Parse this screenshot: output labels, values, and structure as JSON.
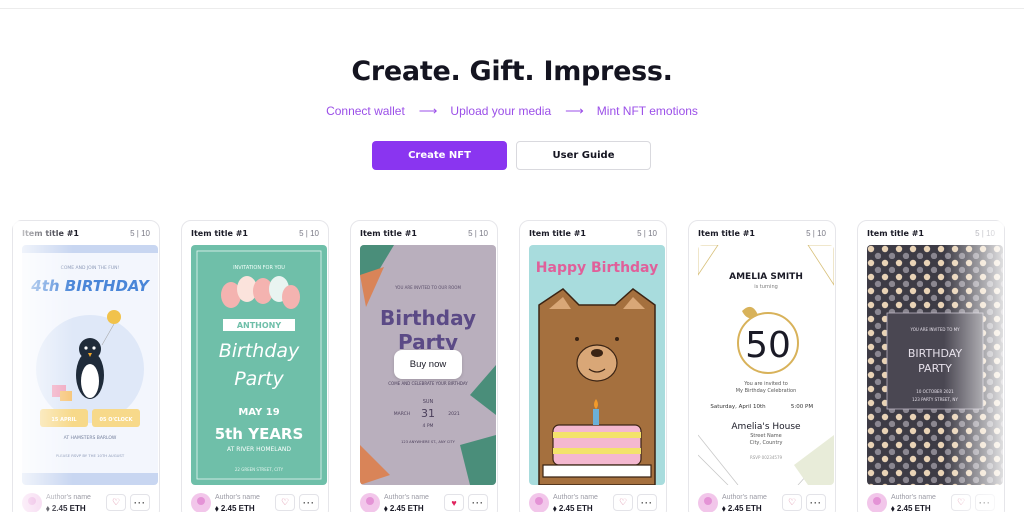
{
  "hero": {
    "title": "Create. Gift. Impress.",
    "steps": [
      "Connect wallet",
      "Upload your media",
      "Mint NFT emotions"
    ],
    "arrow": "⟶"
  },
  "actions": {
    "create_label": "Create NFT",
    "guide_label": "User Guide"
  },
  "cards": [
    {
      "title": "Item title #1",
      "count": "5 | 10",
      "author": "Author's name",
      "price": "2.45 ETH",
      "liked": false,
      "art": {
        "heading": "4th BIRTHDAY",
        "top_line": "COME AND JOIN THE FUN!",
        "date_left": "15 APRIL",
        "date_right": "05 O'CLOCK",
        "place": "AT HAMSTERS BARLOW",
        "rsvp": "PLEASE RSVP BY THE 10TH AUGUST"
      }
    },
    {
      "title": "Item title #1",
      "count": "5 | 10",
      "author": "Author's name",
      "price": "2.45 ETH",
      "liked": false,
      "art": {
        "top_line": "INVITATION FOR YOU",
        "name": "ANTHONY",
        "heading1": "Birthday",
        "heading2": "Party",
        "date": "MAY 19",
        "years": "5th YEARS",
        "place": "AT RIVER HOMELAND",
        "footer": "22 GREEN STREET, CITY"
      }
    },
    {
      "title": "Item title #1",
      "count": "5 | 10",
      "author": "Author's name",
      "price": "2.45 ETH",
      "liked": true,
      "buy_label": "Buy now",
      "art": {
        "top_line": "YOU ARE INVITED TO OUR ROOM",
        "heading1": "Birthday",
        "heading2": "Party",
        "sub": "COME AND CELEBRATE YOUR BIRTHDAY",
        "day_name": "SUN",
        "month": "MARCH",
        "day": "31",
        "year": "2021",
        "time": "4 PM",
        "footer": "123 ANYWHERE ST., ANY CITY"
      }
    },
    {
      "title": "Item title #1",
      "count": "5 | 10",
      "author": "Author's name",
      "price": "2.45 ETH",
      "liked": false,
      "art": {
        "heading": "Happy Birthday"
      }
    },
    {
      "title": "Item title #1",
      "count": "5 | 10",
      "author": "Author's name",
      "price": "2.45 ETH",
      "liked": false,
      "art": {
        "name": "AMELIA SMITH",
        "sub": "is turning",
        "number": "50",
        "invite1": "You are invited to",
        "invite2": "My Birthday Celebration",
        "date": "Saturday, April 10th",
        "time": "5:00 PM",
        "venue": "Amelia's House",
        "addr1": "Street Name",
        "addr2": "City, Country",
        "rsvp": "RSVP 00234579"
      }
    },
    {
      "title": "Item title #1",
      "count": "5 | 10",
      "author": "Author's name",
      "price": "2.45 ETH",
      "liked": false,
      "art": {
        "top_line": "YOU ARE INVITED TO MY",
        "heading1": "BIRTHDAY",
        "heading2": "PARTY",
        "date": "10 OCTOBER 2021",
        "addr": "123 PARTY STREET, NY"
      }
    }
  ],
  "colors": {
    "accent": "#8a35f0",
    "step_text": "#9b4fe8",
    "heart_active": "#e0245e"
  },
  "icons": {
    "like": "heart-icon",
    "more": "more-icon",
    "price": "ethereum-icon"
  }
}
